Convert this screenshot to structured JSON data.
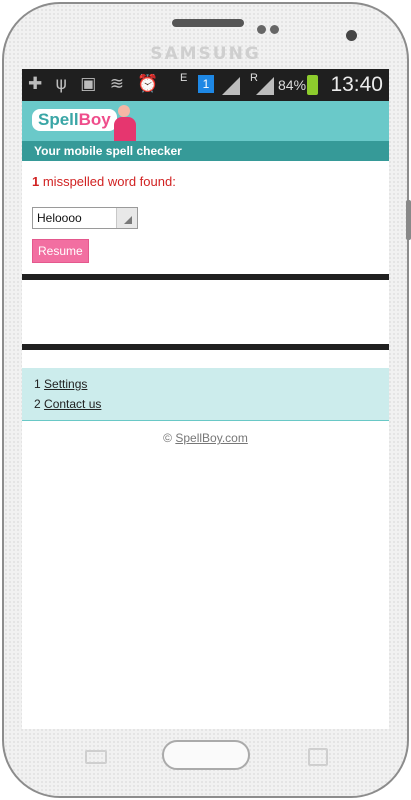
{
  "device": {
    "brand": "SAMSUNG"
  },
  "status_bar": {
    "icons_left": "✚ ψ ▣ ≋ ⏰",
    "network_e": "E",
    "network_r": "R",
    "notification_count": "1",
    "battery_percent": "84%",
    "time": "13:40"
  },
  "app": {
    "logo_main": "Spell",
    "logo_accent": "Boy",
    "tagline": "Your mobile spell checker"
  },
  "results": {
    "count": "1",
    "message": " misspelled word found:"
  },
  "word_select": {
    "selected": "Heloooo"
  },
  "buttons": {
    "resume": "Resume"
  },
  "menu": [
    {
      "number": "1",
      "label": "Settings"
    },
    {
      "number": "2",
      "label": "Contact us"
    }
  ],
  "footer": {
    "copyright_symbol": "©",
    "site": "SpellBoy.com"
  },
  "colors": {
    "header_bg": "#6ac9c9",
    "tagline_bg": "#369a98",
    "error_text": "#d12222",
    "button_bg": "#f26fa1",
    "links_bg": "#ccecec"
  }
}
